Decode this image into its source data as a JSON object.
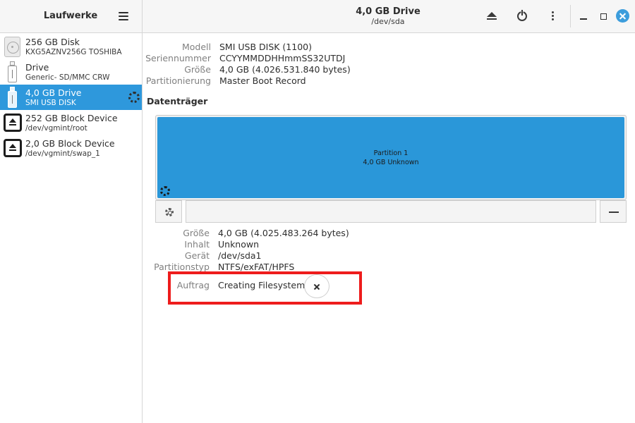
{
  "header": {
    "sidebar_title": "Laufwerke",
    "window_title": "4,0 GB Drive",
    "window_subtitle": "/dev/sda"
  },
  "icons": {
    "menu": "hamburger-menu-icon",
    "eject": "eject-icon",
    "power": "power-icon",
    "more": "vertical-dots-icon",
    "minimize": "minimize-icon",
    "maximize": "maximize-icon",
    "close": "close-icon",
    "gear": "gear-icon",
    "minus": "minus-icon",
    "cancel": "x-icon"
  },
  "colors": {
    "accent": "#2e98dc",
    "highlight": "#ee1c1c"
  },
  "sidebar": {
    "drives": [
      {
        "name": "256 GB Disk",
        "sub": "KXG5AZNV256G TOSHIBA"
      },
      {
        "name": "Drive",
        "sub": "Generic- SD/MMC CRW"
      },
      {
        "name": "4,0 GB Drive",
        "sub": "SMI USB DISK"
      },
      {
        "name": "252 GB Block Device",
        "sub": "/dev/vgmint/root"
      },
      {
        "name": "2,0 GB Block Device",
        "sub": "/dev/vgmint/swap_1"
      }
    ]
  },
  "drive_info": {
    "model_label": "Modell",
    "model_value": "SMI USB DISK (1100)",
    "serial_label": "Seriennummer",
    "serial_value": "CCYYMMDDHHmmSS32UTDJ",
    "size_label": "Größe",
    "size_value": "4,0 GB (4.026.531.840 bytes)",
    "partitioning_label": "Partitionierung",
    "partitioning_value": "Master Boot Record"
  },
  "volumes": {
    "title": "Datenträger",
    "partition_name": "Partition 1",
    "partition_sub": "4,0 GB Unknown"
  },
  "partition_info": {
    "size_label": "Größe",
    "size_value": "4,0 GB (4.025.483.264 bytes)",
    "content_label": "Inhalt",
    "content_value": "Unknown",
    "device_label": "Gerät",
    "device_value": "/dev/sda1",
    "type_label": "Partitionstyp",
    "type_value": "NTFS/exFAT/HPFS",
    "job_label": "Auftrag",
    "job_value": "Creating Filesystem"
  }
}
